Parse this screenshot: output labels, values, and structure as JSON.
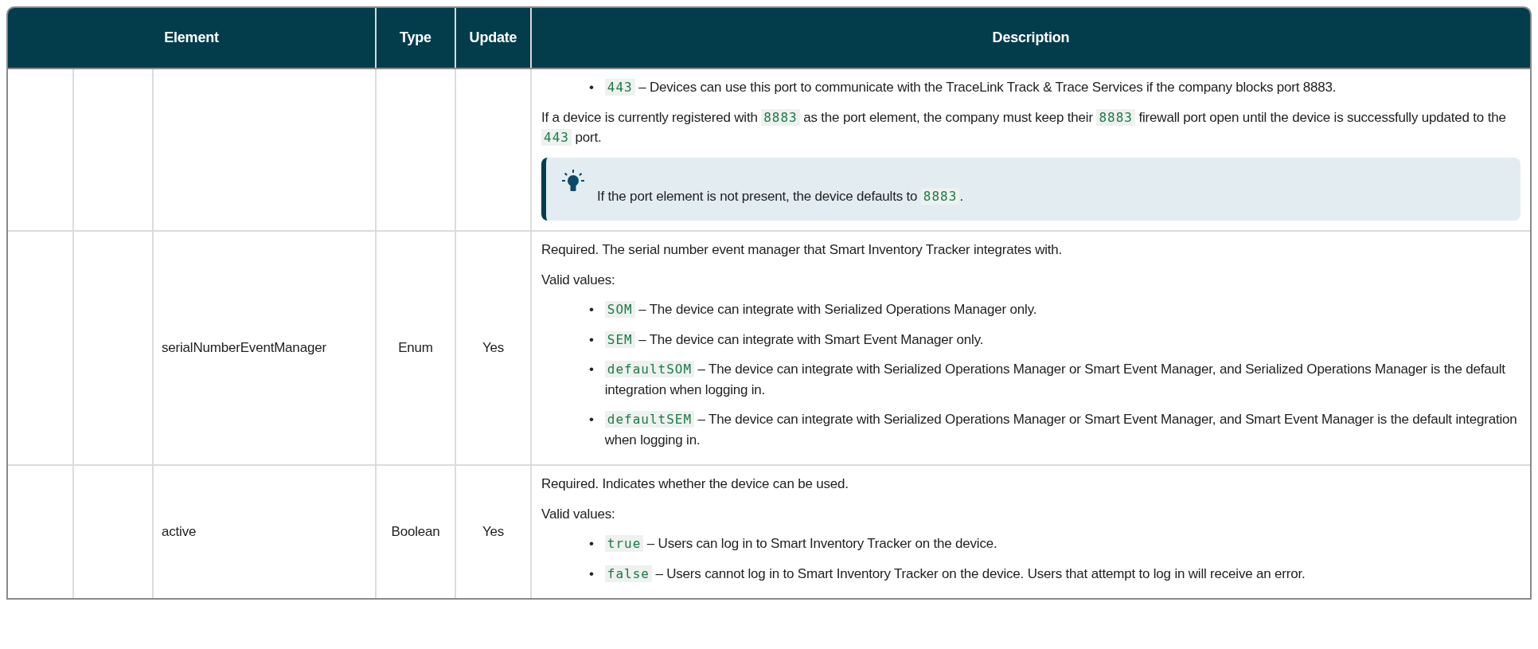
{
  "table": {
    "columns": [
      {
        "label": "Element"
      },
      {
        "label": "Type"
      },
      {
        "label": "Update"
      },
      {
        "label": "Description"
      }
    ],
    "rows": [
      {
        "description": [
          {
            "kind": "bullets",
            "items": [
              {
                "marker": "•",
                "parts": [
                  {
                    "kind": "code",
                    "text": "443"
                  },
                  {
                    "kind": "text",
                    "text": " – Devices can use this port to communicate with the TraceLink Track & Trace Services if the company blocks port 8883."
                  }
                ]
              }
            ]
          },
          {
            "kind": "paragraph",
            "parts": [
              {
                "kind": "text",
                "text": "If a device is currently registered with "
              },
              {
                "kind": "code",
                "text": "8883"
              },
              {
                "kind": "text",
                "text": " as the port element, the company must keep their "
              },
              {
                "kind": "code",
                "text": "8883"
              },
              {
                "kind": "text",
                "text": " firewall port open until the device is successfully updated to the "
              },
              {
                "kind": "code",
                "text": "443"
              },
              {
                "kind": "text",
                "text": " port."
              }
            ]
          },
          {
            "kind": "tip",
            "parts": [
              {
                "kind": "text",
                "text": "If the port element is not present, the device defaults to "
              },
              {
                "kind": "code",
                "text": "8883"
              },
              {
                "kind": "text",
                "text": "."
              }
            ]
          }
        ]
      },
      {
        "element": "serialNumberEventManager",
        "type": "Enum",
        "update": "Yes",
        "description": [
          {
            "kind": "paragraph",
            "parts": [
              {
                "kind": "text",
                "text": "Required. The serial number event manager that Smart Inventory Tracker integrates with."
              }
            ]
          },
          {
            "kind": "paragraph",
            "parts": [
              {
                "kind": "text",
                "text": "Valid values:"
              }
            ]
          },
          {
            "kind": "bullets",
            "items": [
              {
                "marker": "•",
                "parts": [
                  {
                    "kind": "code",
                    "text": "SOM"
                  },
                  {
                    "kind": "text",
                    "text": " – The device can integrate with Serialized Operations Manager only."
                  }
                ]
              },
              {
                "marker": "•",
                "parts": [
                  {
                    "kind": "code",
                    "text": "SEM"
                  },
                  {
                    "kind": "text",
                    "text": " – The device can integrate with Smart Event Manager only."
                  }
                ]
              },
              {
                "marker": "•",
                "parts": [
                  {
                    "kind": "code",
                    "text": "defaultSOM"
                  },
                  {
                    "kind": "text",
                    "text": " – The device can integrate with Serialized Operations Manager or Smart Event Manager, and Serialized Operations Manager is the default integration when logging in."
                  }
                ]
              },
              {
                "marker": "•",
                "parts": [
                  {
                    "kind": "code",
                    "text": "defaultSEM"
                  },
                  {
                    "kind": "text",
                    "text": " – The device can integrate with Serialized Operations Manager or Smart Event Manager, and Smart Event Manager is the default integration when logging in."
                  }
                ]
              }
            ]
          }
        ]
      },
      {
        "element": "active",
        "type": "Boolean",
        "update": "Yes",
        "description": [
          {
            "kind": "paragraph",
            "parts": [
              {
                "kind": "text",
                "text": "Required. Indicates whether the device can be used."
              }
            ]
          },
          {
            "kind": "paragraph",
            "parts": [
              {
                "kind": "text",
                "text": "Valid values:"
              }
            ]
          },
          {
            "kind": "bullets",
            "items": [
              {
                "marker": "•",
                "parts": [
                  {
                    "kind": "code",
                    "text": "true"
                  },
                  {
                    "kind": "text",
                    "text": " – Users can log in to Smart Inventory Tracker on the device."
                  }
                ]
              },
              {
                "marker": "•",
                "parts": [
                  {
                    "kind": "code",
                    "text": "false"
                  },
                  {
                    "kind": "text",
                    "text": " – Users cannot log in to Smart Inventory Tracker on the device. Users that attempt to log in will receive an error."
                  }
                ]
              }
            ]
          }
        ]
      }
    ]
  }
}
